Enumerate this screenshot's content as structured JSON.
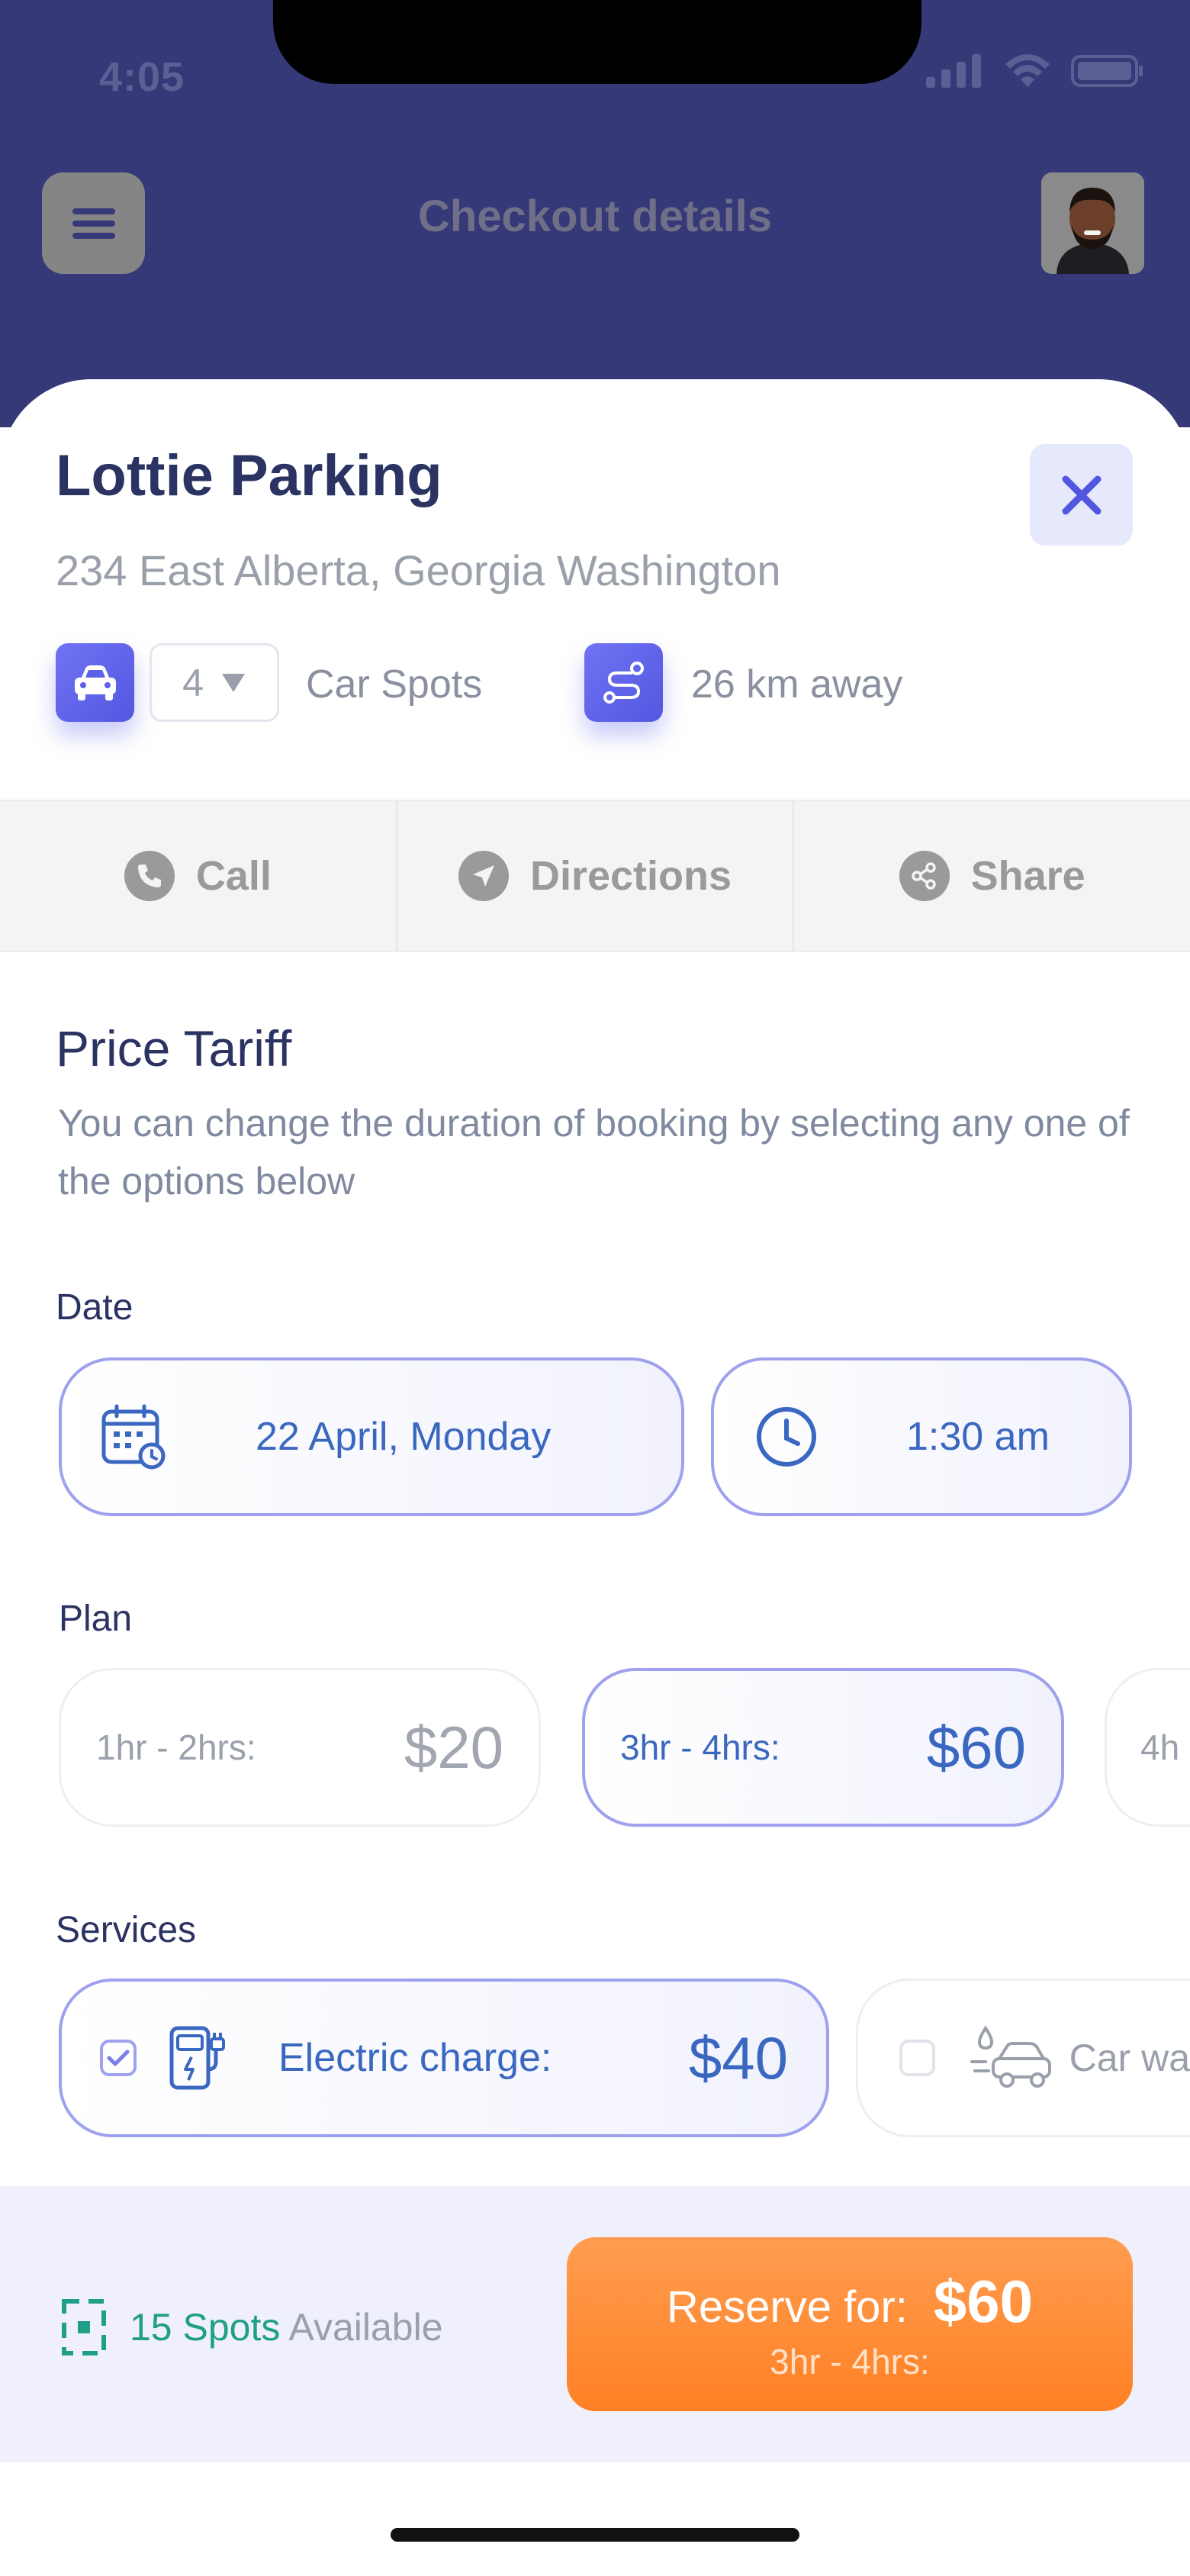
{
  "status_bar": {
    "time": "4:05"
  },
  "header": {
    "title": "Checkout details"
  },
  "place": {
    "name": "Lottie Parking",
    "address": "234 East Alberta, Georgia Washington",
    "spots_count": "4",
    "spots_label": "Car Spots",
    "distance": "26 km away"
  },
  "actions": [
    {
      "label": "Call"
    },
    {
      "label": "Directions"
    },
    {
      "label": "Share"
    }
  ],
  "tariff": {
    "title": "Price Tariff",
    "description": "You can change the duration of booking by selecting any one of the options below"
  },
  "date_section": {
    "label": "Date",
    "date": "22 April, Monday",
    "time": "1:30 am"
  },
  "plan_section": {
    "label": "Plan",
    "plans": [
      {
        "duration": "1hr - 2hrs:",
        "price": "$20",
        "selected": false
      },
      {
        "duration": "3hr - 4hrs:",
        "price": "$60",
        "selected": true
      },
      {
        "duration": "4h",
        "price": "",
        "selected": false
      }
    ]
  },
  "services_section": {
    "label": "Services",
    "services": [
      {
        "name": "Electric charge:",
        "price": "$40",
        "checked": true
      },
      {
        "name": "Car wa",
        "price": "",
        "checked": false
      }
    ]
  },
  "footer": {
    "spots_number": "15 Spots",
    "spots_suffix": "Available",
    "reserve_label": "Reserve for:",
    "reserve_price": "$60",
    "reserve_plan": "3hr - 4hrs:"
  },
  "colors": {
    "header_bg": "#363977",
    "accent": "#5257e0",
    "price_blue": "#3a68c0",
    "cta_orange": "#ff8a33",
    "available_green": "#1f9e88"
  }
}
